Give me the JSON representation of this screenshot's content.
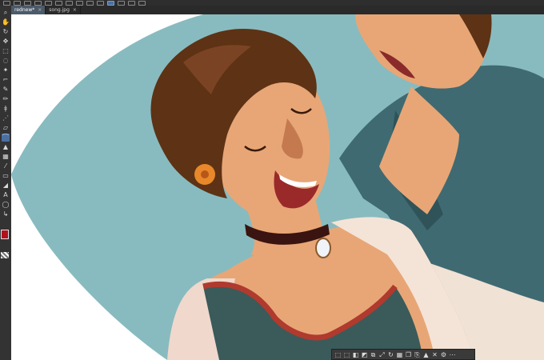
{
  "tabs": [
    {
      "label": "rednew*",
      "close": "×",
      "active": true
    },
    {
      "label": "song.jpg",
      "close": "×",
      "active": false
    }
  ],
  "top_toolbar": {
    "icons": [
      "new-file-icon",
      "open-file-icon",
      "save-icon",
      "undo-icon",
      "redo-icon",
      "copy-icon",
      "paste-icon",
      "transform-icon",
      "select-icon",
      "lasso-icon",
      "active-tool-icon",
      "view-icon",
      "grid-icon",
      "ruler-icon"
    ]
  },
  "tools": [
    {
      "name": "zoom-icon",
      "glyph": "⌕"
    },
    {
      "name": "hand-icon",
      "glyph": "✋"
    },
    {
      "name": "rotate-icon",
      "glyph": "↻"
    },
    {
      "name": "move-icon",
      "glyph": "✥"
    },
    {
      "name": "select-rect-icon",
      "glyph": "⬚"
    },
    {
      "name": "lasso-icon",
      "glyph": "◌"
    },
    {
      "name": "magic-wand-icon",
      "glyph": "✦"
    },
    {
      "name": "eyedropper-icon",
      "glyph": "⌐"
    },
    {
      "name": "pen-icon",
      "glyph": "✎"
    },
    {
      "name": "pencil-icon",
      "glyph": "✏"
    },
    {
      "name": "brush-icon",
      "glyph": "ǂ"
    },
    {
      "name": "airbrush-icon",
      "glyph": "⋰"
    },
    {
      "name": "eraser-icon",
      "glyph": "▱"
    },
    {
      "name": "blend-icon",
      "glyph": "⌒"
    },
    {
      "name": "fill-icon",
      "glyph": "▲"
    },
    {
      "name": "gradient-icon",
      "glyph": "▦"
    },
    {
      "name": "figure-icon",
      "glyph": "⁄"
    },
    {
      "name": "frame-icon",
      "glyph": "▭"
    },
    {
      "name": "ruler-icon",
      "glyph": "◢"
    },
    {
      "name": "text-icon",
      "glyph": "A"
    },
    {
      "name": "balloon-icon",
      "glyph": "◯"
    },
    {
      "name": "correct-line-icon",
      "glyph": "↳"
    }
  ],
  "colors": {
    "foreground": "#b3101d",
    "background_teal": "#88bbbf",
    "jacket_teal": "#3f6a72",
    "hair_brown": "#5e3214",
    "skin": "#e8a676",
    "choker": "#3a1410",
    "trim_red": "#b03a2e",
    "bodice_green": "#3b5a5a"
  },
  "float_toolbar": {
    "icons": [
      "select-all-icon",
      "deselect-icon",
      "invert-icon",
      "transform-icon",
      "crop-icon",
      "scale-icon",
      "rotate-icon",
      "grid-icon",
      "copy-icon",
      "paste-icon",
      "fill-icon",
      "clear-icon",
      "settings-icon",
      "more-icon"
    ]
  }
}
